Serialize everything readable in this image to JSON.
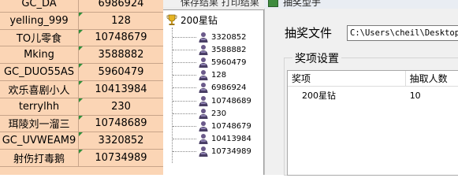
{
  "spreadsheet": {
    "rows": [
      [
        "GC_DA",
        "6986924"
      ],
      [
        "yelling_999",
        "128"
      ],
      [
        "TO儿零食",
        "10748679"
      ],
      [
        "Mking",
        "3588882"
      ],
      [
        "GC_DUO55AS",
        "5960479"
      ],
      [
        "欢乐喜剧小人",
        "10413984"
      ],
      [
        "terrylhh",
        "230"
      ],
      [
        "珥陵刘一溜三",
        "10748689"
      ],
      [
        "GC_UVWEAM9",
        "3320852"
      ],
      [
        "射伤打毒鹅",
        "10734989"
      ]
    ]
  },
  "tree_window": {
    "menu_text": "保存结果  打印结果",
    "root_label": "200星钻",
    "root_icon": "trophy-icon",
    "node_icon": "person-icon",
    "nodes": [
      "3320852",
      "3588882",
      "5960479",
      "128",
      "6986924",
      "10748689",
      "230",
      "10748679",
      "10413984",
      "10734989"
    ]
  },
  "dialog": {
    "title": "抽奖型手",
    "file_label": "抽奖文件",
    "file_path": "C:\\Users\\cheil\\Desktop\\",
    "group_label": "奖项设置",
    "list_headers": [
      "奖项",
      "抽取人数"
    ],
    "list_rows": [
      {
        "prize": "200星钻",
        "count": "10"
      }
    ]
  }
}
